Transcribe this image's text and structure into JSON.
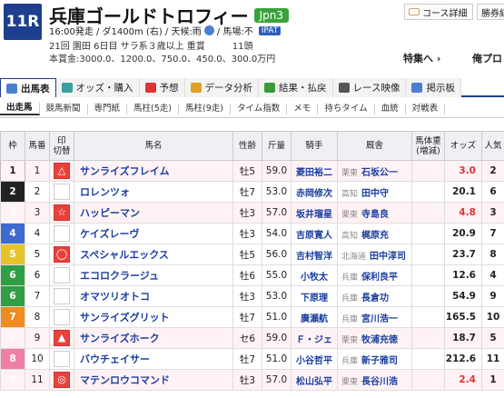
{
  "header": {
    "race_number": "11R",
    "race_name": "兵庫ゴールドトロフィー",
    "grade": "Jpn3",
    "info_start": "16:00発走 / ダ1400m (右) / 天候:雨",
    "info_track": "/ 馬場:不",
    "ipat": "IPAT",
    "info_meeting": "21回 園田 6日目 サラ系３歳以上 重賞　　　11頭",
    "info_prize": "本賞金:3000.0、1200.0、750.0、450.0、300.0万円",
    "btn_course": "コース詳細",
    "btn_result": "勝券結",
    "link_special": "特集へ ›",
    "link_ore": "俺プロ"
  },
  "main_tabs": [
    {
      "label": "出馬表",
      "color": "#4a7fd0"
    },
    {
      "label": "オッズ・購入",
      "color": "#3aa0a0"
    },
    {
      "label": "予想",
      "color": "#d33"
    },
    {
      "label": "データ分析",
      "color": "#e0a020"
    },
    {
      "label": "結果・払戻",
      "color": "#3a9a3a"
    },
    {
      "label": "レース映像",
      "color": "#555"
    },
    {
      "label": "掲示板",
      "color": "#4a7fd0"
    }
  ],
  "sub_tabs": [
    "出走馬",
    "競馬新聞",
    "専門紙",
    "馬柱(5走)",
    "馬柱(9走)",
    "タイム指数",
    "メモ",
    "持ちタイム",
    "血統",
    "対戦表"
  ],
  "table_headers": {
    "waku": "枠",
    "umaban": "馬番",
    "mark": "印",
    "mark_sub": "切替",
    "horse": "馬名",
    "sexage": "性齢",
    "kinryo": "斤量",
    "jockey": "騎手",
    "trainer": "厩舎",
    "weight": "馬体重(増減)",
    "odds": "オッズ",
    "pop": "人気"
  },
  "entries": [
    {
      "waku": "1",
      "umaban": "1",
      "mark": "△",
      "horse": "サンライズフレイム",
      "sexage": "牡5",
      "kinryo": "59.0",
      "jockey": "菱田裕二",
      "area": "栗東",
      "trainer": "石坂公一",
      "odds": "3.0",
      "pop": "2",
      "fav": true
    },
    {
      "waku": "2",
      "umaban": "2",
      "mark": "",
      "horse": "ロレンツォ",
      "sexage": "牡7",
      "kinryo": "53.0",
      "jockey": "赤岡修次",
      "area": "高知",
      "trainer": "田中守",
      "odds": "20.1",
      "pop": "6",
      "fav": false
    },
    {
      "waku": "3",
      "umaban": "3",
      "mark": "☆",
      "horse": "ハッピーマン",
      "sexage": "牡3",
      "kinryo": "57.0",
      "jockey": "坂井瑠星",
      "area": "栗東",
      "trainer": "寺島良",
      "odds": "4.8",
      "pop": "3",
      "fav": true
    },
    {
      "waku": "4",
      "umaban": "4",
      "mark": "",
      "horse": "ケイズレーヴ",
      "sexage": "牡3",
      "kinryo": "54.0",
      "jockey": "吉原寛人",
      "area": "高知",
      "trainer": "梶原充",
      "odds": "20.9",
      "pop": "7",
      "fav": false
    },
    {
      "waku": "5",
      "umaban": "5",
      "mark": "◯",
      "horse": "スペシャルエックス",
      "sexage": "牡5",
      "kinryo": "56.0",
      "jockey": "吉村智洋",
      "area": "北海道",
      "trainer": "田中淳司",
      "odds": "23.7",
      "pop": "8",
      "fav": false
    },
    {
      "waku": "6",
      "umaban": "6",
      "mark": "",
      "horse": "エコロクラージュ",
      "sexage": "牡6",
      "kinryo": "55.0",
      "jockey": "小牧太",
      "area": "兵庫",
      "trainer": "保利良平",
      "odds": "12.6",
      "pop": "4",
      "fav": false
    },
    {
      "waku": "6",
      "umaban": "7",
      "mark": "",
      "horse": "オマツリオトコ",
      "sexage": "牡3",
      "kinryo": "53.0",
      "jockey": "下原理",
      "area": "兵庫",
      "trainer": "長倉功",
      "odds": "54.9",
      "pop": "9",
      "fav": false
    },
    {
      "waku": "7",
      "umaban": "8",
      "mark": "",
      "horse": "サンライズグリット",
      "sexage": "牡7",
      "kinryo": "51.0",
      "jockey": "廣瀬航",
      "area": "兵庫",
      "trainer": "宮川浩一",
      "odds": "165.5",
      "pop": "10",
      "fav": false
    },
    {
      "waku": "7",
      "umaban": "9",
      "mark": "▲",
      "horse": "サンライズホーク",
      "sexage": "セ6",
      "kinryo": "59.0",
      "jockey": "Ｆ・ジェ",
      "area": "栗東",
      "trainer": "牧浦充徳",
      "odds": "18.7",
      "pop": "5",
      "fav": false
    },
    {
      "waku": "8",
      "umaban": "10",
      "mark": "",
      "horse": "バウチェイサー",
      "sexage": "牡7",
      "kinryo": "51.0",
      "jockey": "小谷哲平",
      "area": "兵庫",
      "trainer": "新子雅司",
      "odds": "212.6",
      "pop": "11",
      "fav": false
    },
    {
      "waku": "8",
      "umaban": "11",
      "mark": "◎",
      "horse": "マテンロウコマンド",
      "sexage": "牡3",
      "kinryo": "57.0",
      "jockey": "松山弘平",
      "area": "栗東",
      "trainer": "長谷川浩",
      "odds": "2.4",
      "pop": "1",
      "fav": true
    }
  ]
}
